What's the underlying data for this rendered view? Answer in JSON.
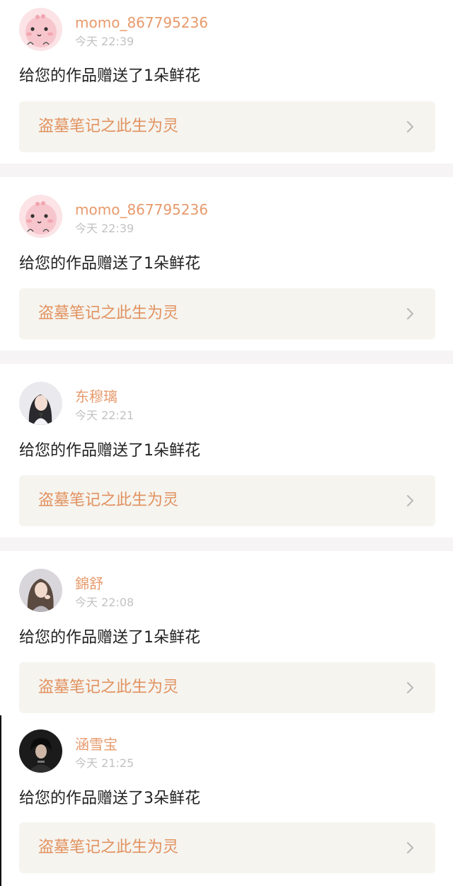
{
  "colors": {
    "username": "#e79a6c",
    "work_title": "#e2915f",
    "timestamp": "#c2c2c2",
    "message": "#222222",
    "link_bg": "#f5f4ef",
    "separator": "#f6f4f4"
  },
  "icons": {
    "link_arrow": "chevron-right-icon"
  },
  "notifications": [
    {
      "username": "momo_867795236",
      "time": "今天 22:39",
      "message": "给您的作品赠送了1朵鲜花",
      "work_title": "盗墓笔记之此生为灵"
    },
    {
      "username": "momo_867795236",
      "time": "今天 22:39",
      "message": "给您的作品赠送了1朵鲜花",
      "work_title": "盗墓笔记之此生为灵"
    },
    {
      "username": "东穆璃",
      "time": "今天 22:21",
      "message": "给您的作品赠送了1朵鲜花",
      "work_title": "盗墓笔记之此生为灵"
    },
    {
      "username": "錦舒",
      "time": "今天 22:08",
      "message": "给您的作品赠送了1朵鲜花",
      "work_title": "盗墓笔记之此生为灵"
    },
    {
      "username": "涵雪宝",
      "time": "今天 21:25",
      "message": "给您的作品赠送了3朵鲜花",
      "work_title": "盗墓笔记之此生为灵"
    }
  ]
}
